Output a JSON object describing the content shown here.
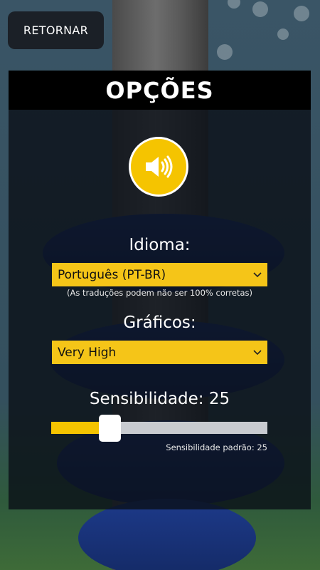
{
  "header": {
    "back_label": "RETORNAR"
  },
  "panel": {
    "title": "OPÇÕES",
    "sound": {
      "icon": "speaker-icon",
      "state": "on"
    },
    "language": {
      "label": "Idioma:",
      "selected": "Português (PT-BR)",
      "note": "(As traduções podem não ser 100% corretas)"
    },
    "graphics": {
      "label": "Gráficos:",
      "selected": "Very High"
    },
    "sensitivity": {
      "label": "Sensibilidade: 25",
      "value": 25,
      "fill_fraction": 0.27,
      "default_note": "Sensibilidade padrão: 25"
    }
  },
  "colors": {
    "accent": "#f5c400",
    "panel": "#0a0f16",
    "header": "#000000"
  }
}
